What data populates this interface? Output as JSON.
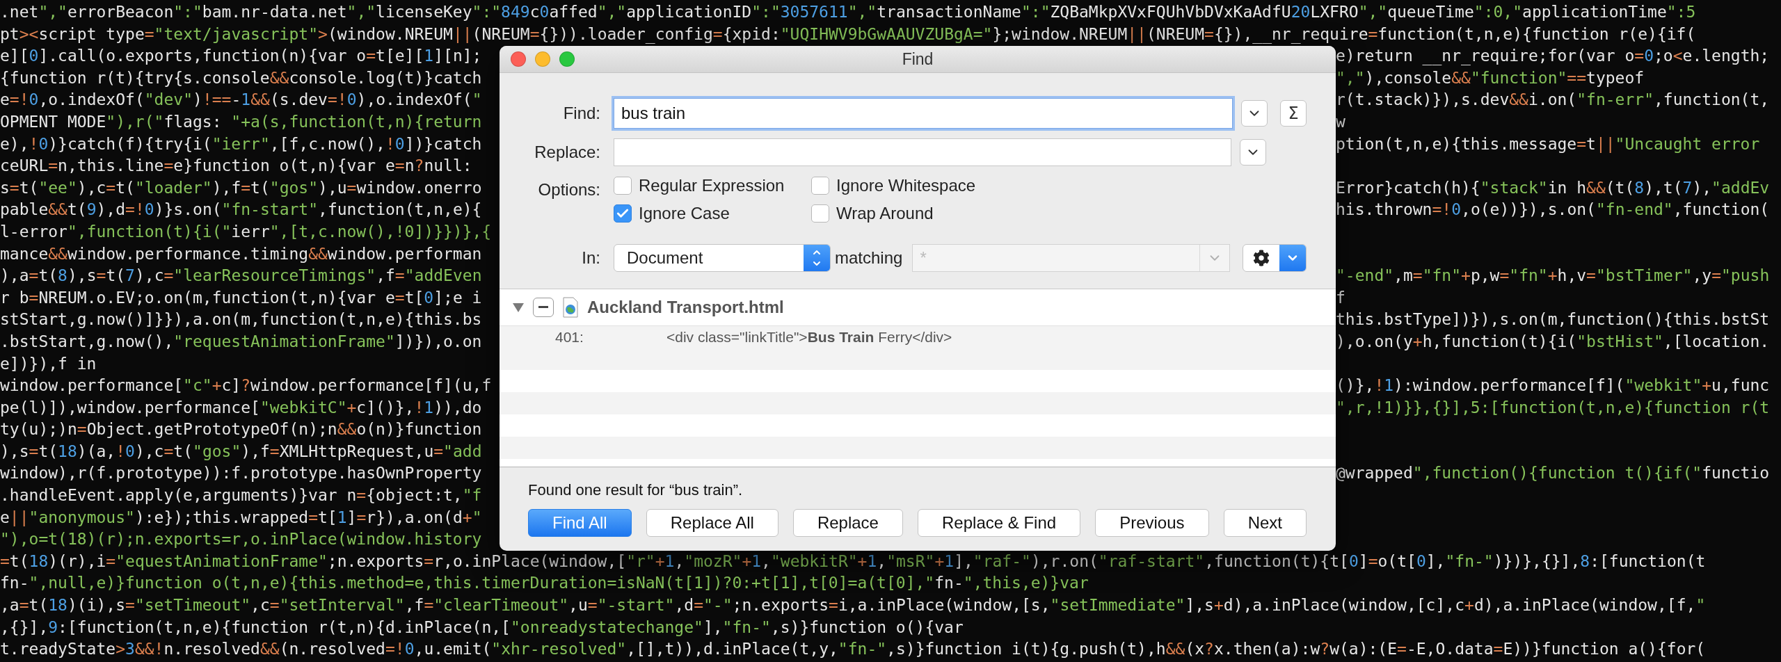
{
  "code_lines": [
    {
      "kind": "full",
      "text": ".net\",\"errorBeacon\":\"bam.nr-data.net\",\"licenseKey\":\"849c0affed\",\"applicationID\":\"3057611\",\"transactionName\":\"ZQBaMkpXVxFQUhVbDVxKaAdfU20LXFRO\",\"queueTime\":0,\"applicationTime\":5"
    },
    {
      "kind": "full",
      "text": "pt><script type=\"text/javascript\">(window.NREUM||(NREUM={})).loader_config={xpid:\"UQIHWV9bGwAAUVZUBgA=\"};window.NREUM||(NREUM={}),__nr_require=function(t,n,e){function r(e){if("
    },
    {
      "kind": "split",
      "left": "e][0].call(o.exports,function(n){var o=t[e][1][n];",
      "right": "e)return __nr_require;for(var o=0;o<e.length;"
    },
    {
      "kind": "split",
      "left": "{function r(t){try{s.console&&console.log(t)}catch",
      "right": "\",\"),console&&\"function\"==typeof"
    },
    {
      "kind": "split",
      "left": "e=!0,o.indexOf(\"dev\")!==-1&&(s.dev=!0),o.indexOf(\"",
      "right": "r(t.stack)}),s.dev&&i.on(\"fn-err\",function(t,"
    },
    {
      "kind": "split",
      "left": "OPMENT MODE\"),r(\"flags: \"+a(s,function(t,n){return",
      "right": "w"
    },
    {
      "kind": "split",
      "left": "e),!0)}catch(f){try{i(\"ierr\",[f,c.now(),!0])}catch",
      "right": "ption(t,n,e){this.message=t||\"Uncaught error"
    },
    {
      "kind": "split",
      "left": "ceURL=n,this.line=e}function o(t,n){var e=n?null:"
    },
    {
      "kind": "split",
      "left": "s=t(\"ee\"),c=t(\"loader\"),f=t(\"gos\"),u=window.onerro",
      "right": "Error}catch(h){\"stack\"in h&&(t(8),t(7),\"addEv"
    },
    {
      "kind": "split",
      "left": "pable&&t(9),d=!0)}s.on(\"fn-start\",function(t,n,e){",
      "right": "his.thrown=!0,o(e))}),s.on(\"fn-end\",function("
    },
    {
      "kind": "split",
      "left": "l-error\",function(t){i(\"ierr\",[t,c.now(),!0])}})},{"
    },
    {
      "kind": "split",
      "left": "mance&&window.performance.timing&&window.performan"
    },
    {
      "kind": "split",
      "left": "),a=t(8),s=t(7),c=\"learResourceTimings\",f=\"addEven",
      "right": "\"-end\",m=\"fn\"+p,w=\"fn\"+h,v=\"bstTimer\",y=\"push"
    },
    {
      "kind": "split",
      "left": "r b=NREUM.o.EV;o.on(m,function(t,n){var e=t[0];e i",
      "right": "f"
    },
    {
      "kind": "split",
      "left": "stStart,g.now()]}}),a.on(m,function(t,n,e){this.bs",
      "right": "this.bstType])}),s.on(m,function(){this.bstSt"
    },
    {
      "kind": "split",
      "left": ".bstStart,g.now(),\"requestAnimationFrame\"])}),o.on",
      "right": "),o.on(y+h,function(t){i(\"bstHist\",[location."
    },
    {
      "kind": "split",
      "left": "e])}),f in"
    },
    {
      "kind": "split",
      "left": "window.performance[\"c\"+c]?window.performance[f](u,f",
      "right": "()},!1):window.performance[f](\"webkit\"+u,func"
    },
    {
      "kind": "split",
      "left": "pe(l)]),window.performance[\"webkitC\"+c]()},!1)),do",
      "right": "\",r,!1)}},{}],5:[function(t,n,e){function r(t"
    },
    {
      "kind": "split",
      "left": "ty(u);)n=Object.getPrototypeOf(n);n&&o(n)}function"
    },
    {
      "kind": "split",
      "left": "),s=t(18)(a,!0),c=t(\"gos\"),f=XMLHttpRequest,u=\"add"
    },
    {
      "kind": "split",
      "left": "window),r(f.prototype)):f.prototype.hasOwnProperty",
      "right": "@wrapped\",function(){function t(){if(\"functio"
    },
    {
      "kind": "split",
      "left": ".handleEvent.apply(e,arguments)}var n={object:t,\"f"
    },
    {
      "kind": "split",
      "left": "e||\"anonymous\"):e});this.wrapped=t[1]=r}),a.on(d+\""
    },
    {
      "kind": "split",
      "left": "\"),o=t(18)(r);n.exports=r,o.inPlace(window.history"
    },
    {
      "kind": "full",
      "text": "=t(18)(r),i=\"equestAnimationFrame\";n.exports=r,o.inPlace(window,[\"r\"+1,\"mozR\"+1,\"webkitR\"+1,\"msR\"+1],\"raf-\"),r.on(\"raf-start\",function(t){t[0]=o(t[0],\"fn-\")})},{}],8:[function(t"
    },
    {
      "kind": "full",
      "text": "fn-\",null,e)}function o(t,n,e){this.method=e,this.timerDuration=isNaN(t[1])?0:+t[1],t[0]=a(t[0],\"fn-\",this,e)}var"
    },
    {
      "kind": "full",
      "text": ",a=t(18)(i),s=\"setTimeout\",c=\"setInterval\",f=\"clearTimeout\",u=\"-start\",d=\"-\";n.exports=i,a.inPlace(window,[s,\"setImmediate\"],s+d),a.inPlace(window,[c],c+d),a.inPlace(window,[f,\""
    },
    {
      "kind": "full",
      "text": ",{}],9:[function(t,n,e){function r(t,n){d.inPlace(n,[\"onreadystatechange\"],\"fn-\",s)}function o(){var"
    },
    {
      "kind": "full",
      "text": "t.readyState>3&&!n.resolved&&(n.resolved=!0,u.emit(\"xhr-resolved\",[],t)),d.inPlace(t,y,\"fn-\",s)}function i(t){g.push(t),h&&(x?x.then(a):w?w(a):(E=-E,O.data=E))}function a(){for("
    }
  ],
  "find_dialog": {
    "title": "Find",
    "find": {
      "label": "Find:",
      "value": "bus train",
      "focused": true,
      "sum_label": "Σ"
    },
    "replace": {
      "label": "Replace:"
    },
    "options": {
      "label": "Options:",
      "items": [
        {
          "label": "Regular Expression",
          "checked": false
        },
        {
          "label": "Ignore Whitespace",
          "checked": false
        },
        {
          "label": "Ignore Case",
          "checked": true
        },
        {
          "label": "Wrap Around",
          "checked": false
        }
      ]
    },
    "scope": {
      "label": "In:",
      "value": "Document",
      "matching_label": "matching",
      "matching_placeholder": "*",
      "matching_disabled": true
    },
    "results": {
      "file": {
        "name": "Auckland Transport.html",
        "expanded": true
      },
      "matches": [
        {
          "line": "401:",
          "text": "<div class=\"linkTitle\">**Bus Train** Ferry</div>"
        }
      ]
    },
    "status": "Found one result for “bus train”.",
    "buttons": [
      {
        "label": "Find All",
        "default": true
      },
      {
        "label": "Replace All",
        "default": false
      },
      {
        "label": "Replace",
        "default": false
      },
      {
        "label": "Replace & Find",
        "default": false
      },
      {
        "label": "Previous",
        "default": false
      },
      {
        "label": "Next",
        "default": false
      }
    ]
  }
}
